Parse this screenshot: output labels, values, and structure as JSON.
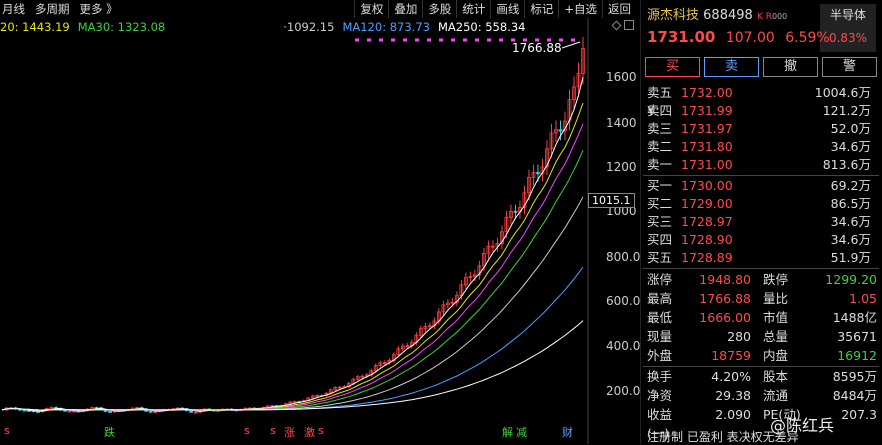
{
  "toolbar": {
    "left": [
      "月线",
      "多周期",
      "更多 》"
    ],
    "right": [
      "复权",
      "叠加",
      "多股",
      "统计",
      "画线",
      "标记",
      "+自选",
      "返回"
    ]
  },
  "ma_legend": [
    {
      "text": "20: 1443.19",
      "color": "#e8e800"
    },
    {
      "text": "MA30: 1323.08",
      "color": "#3fd03f"
    },
    {
      "text": "·1092.15",
      "color": "#cccccc"
    },
    {
      "text": "MA120: 873.73",
      "color": "#4aa0ff"
    },
    {
      "text": "MA250: 558.34",
      "color": "#ffffff"
    }
  ],
  "price_ticks": [
    "1600",
    "1400",
    "1200",
    "1000",
    "800.0",
    "600.0",
    "400.0",
    "200.0"
  ],
  "high_label": "1766.88",
  "flag_price": "1015.1",
  "bottom_marks": [
    {
      "text": "s",
      "color": "#ff4a4a"
    },
    {
      "text": "跌",
      "color": "#3fd03f"
    },
    {
      "text": "s",
      "color": "#ff4a4a"
    },
    {
      "text": "s",
      "color": "#ff4a4a"
    },
    {
      "text": "涨",
      "color": "#ff4a4a"
    },
    {
      "text": "激",
      "color": "#ff4a4a"
    },
    {
      "text": "s",
      "color": "#ff4a4a"
    },
    {
      "text": "解",
      "color": "#3fd03f"
    },
    {
      "text": "减",
      "color": "#3fd03f"
    },
    {
      "text": "财",
      "color": "#5aa0ff"
    }
  ],
  "stock": {
    "name": "源杰科技",
    "code": "688498",
    "tag": "K R",
    "tag_suffix": "000",
    "sector": "半导体",
    "sector_pct": "0.83%",
    "price": "1731.00",
    "change": "107.00",
    "change_pct": "6.59%"
  },
  "buttons": {
    "buy": "买",
    "sell": "卖",
    "cancel": "撤",
    "alert": "警"
  },
  "asks": [
    {
      "label": "卖五",
      "price": "1732.00",
      "vol": "1004.6万",
      "mark": "¥"
    },
    {
      "label": "卖四",
      "price": "1731.99",
      "vol": "121.2万"
    },
    {
      "label": "卖三",
      "price": "1731.97",
      "vol": "52.0万"
    },
    {
      "label": "卖二",
      "price": "1731.80",
      "vol": "34.6万"
    },
    {
      "label": "卖一",
      "price": "1731.00",
      "vol": "813.6万"
    }
  ],
  "bids": [
    {
      "label": "买一",
      "price": "1730.00",
      "vol": "69.2万"
    },
    {
      "label": "买二",
      "price": "1729.00",
      "vol": "86.5万"
    },
    {
      "label": "买三",
      "price": "1728.97",
      "vol": "34.6万"
    },
    {
      "label": "买四",
      "price": "1728.90",
      "vol": "34.6万"
    },
    {
      "label": "买五",
      "price": "1728.89",
      "vol": "51.9万"
    }
  ],
  "stats1": [
    {
      "a": "涨停",
      "b": "1948.80",
      "bc": "red",
      "c": "跌停",
      "d": "1299.20",
      "dc": "grn"
    },
    {
      "a": "最高",
      "b": "1766.88",
      "bc": "red",
      "c": "量比",
      "d": "1.05",
      "dc": "red"
    },
    {
      "a": "最低",
      "b": "1666.00",
      "bc": "red",
      "c": "市值",
      "d": "1488亿",
      "dc": "wht"
    },
    {
      "a": "现量",
      "b": "280",
      "bc": "wht",
      "c": "总量",
      "d": "35671",
      "dc": "wht"
    },
    {
      "a": "外盘",
      "b": "18759",
      "bc": "red",
      "c": "内盘",
      "d": "16912",
      "dc": "grn"
    }
  ],
  "stats2": [
    {
      "a": "换手",
      "b": "4.20%",
      "bc": "wht",
      "c": "股本",
      "d": "8595万",
      "dc": "wht"
    },
    {
      "a": "净资",
      "b": "29.38",
      "bc": "wht",
      "c": "流通",
      "d": "8484万",
      "dc": "wht"
    },
    {
      "a": "收益(一)",
      "b": "2.090",
      "bc": "wht",
      "c": "PE(动)",
      "d": "207.3",
      "dc": "wht"
    }
  ],
  "footer": "注册制 已盈利 表决权无差异",
  "watermark": "@陈红兵"
}
